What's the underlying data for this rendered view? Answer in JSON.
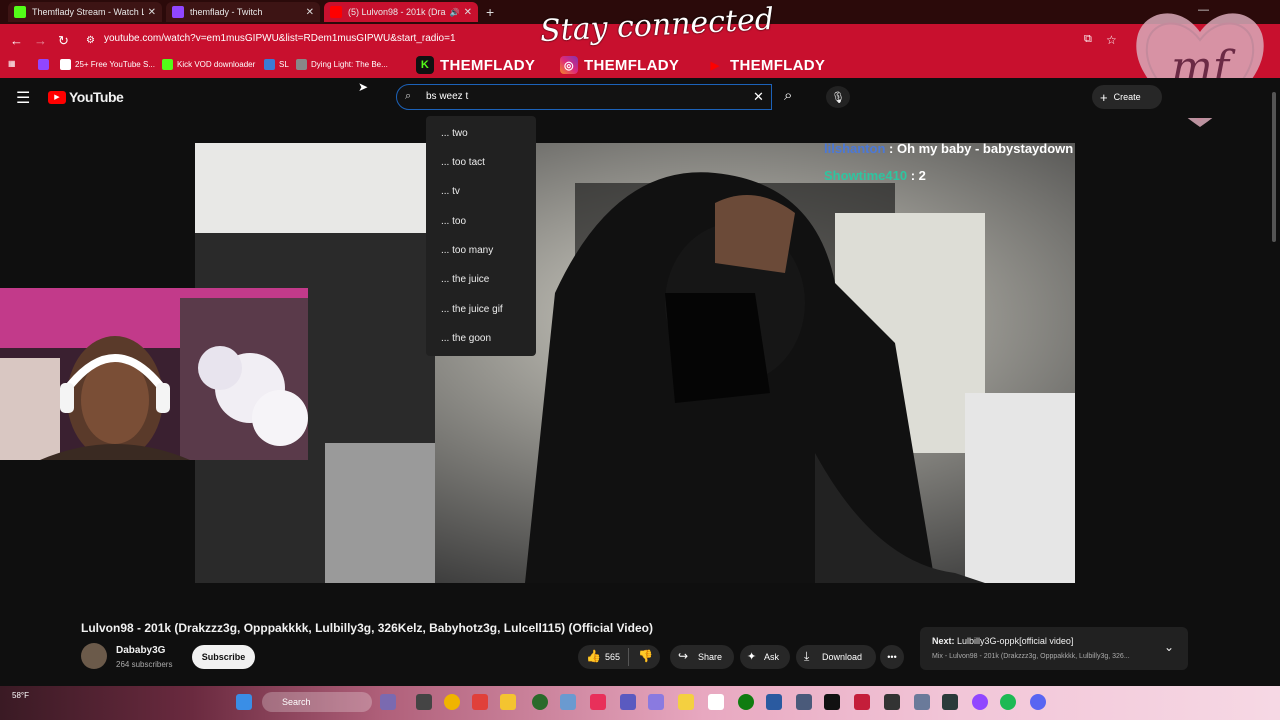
{
  "browser": {
    "tabs": [
      {
        "title": "Themflady Stream - Watch Live",
        "favicon_color": "#53fc18"
      },
      {
        "title": "themflady - Twitch",
        "favicon_color": "#9146ff"
      },
      {
        "title": "(5) Lulvon98 - 201k (Drakzz",
        "favicon_color": "#ff0000"
      }
    ],
    "url": "youtube.com/watch?v=em1musGIPWU&list=RDem1musGIPWU&start_radio=1",
    "bookmarks": [
      {
        "label": "25+ Free YouTube S...",
        "color": "#ffffff"
      },
      {
        "label": "Kick VOD downloader",
        "color": "#53fc18"
      },
      {
        "label": "SL",
        "color": "#3a7bd5"
      },
      {
        "label": "Dying Light: The Be...",
        "color": "#888888"
      }
    ]
  },
  "overlay": {
    "stay_connected": "Stay connected",
    "socials": [
      {
        "platform": "kick",
        "handle": "THEMFLADY",
        "color": "#53fc18"
      },
      {
        "platform": "instagram",
        "handle": "THEMFLADY",
        "color": "#e1306c"
      },
      {
        "platform": "youtube",
        "handle": "THEMFLADY",
        "color": "#ff0000"
      }
    ],
    "logo_initials": "mf"
  },
  "youtube": {
    "logo_text": "YouTube",
    "search_value": "bs weez t",
    "create_label": "Create",
    "suggestions": [
      "... two",
      "... too tact",
      "... tv",
      "... too",
      "... too many",
      "... the juice",
      "... the juice gif",
      "... the goon"
    ],
    "chat": [
      {
        "user": "lilshanton",
        "message": "Oh my baby - babystaydown",
        "user_color": "#4a78d8"
      },
      {
        "user": "Showtime410",
        "message": "2",
        "user_color": "#2ec5a0"
      }
    ],
    "video_title": "Lulvon98 - 201k (Drakzzz3g, Opppakkkk, Lulbilly3g, 326Kelz, Babyhotz3g, Lulcell115) (Official Video)",
    "channel": {
      "name": "Dababy3G",
      "subscribers": "264 subscribers",
      "subscribe_label": "Subscribe"
    },
    "actions": {
      "likes": "565",
      "share": "Share",
      "ask": "Ask",
      "download": "Download"
    },
    "next": {
      "label": "Next:",
      "title": "Lulbilly3G-oppk[official video]",
      "mix": "Mix - Lulvon98 - 201k (Drakzzz3g, Opppakkkk, Lulbilly3g, 326..."
    }
  },
  "taskbar": {
    "search_label": "Search",
    "weather": "58°F"
  }
}
